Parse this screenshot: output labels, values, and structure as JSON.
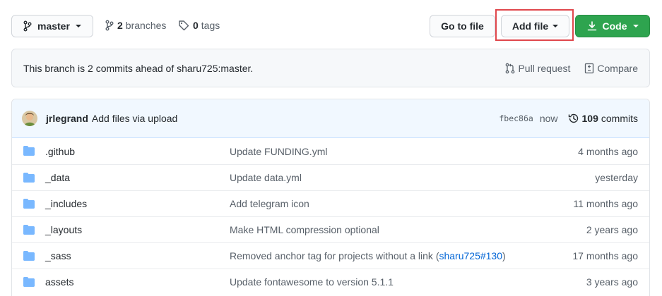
{
  "toolbar": {
    "branch_label": "master",
    "branches_count": "2",
    "branches_word": "branches",
    "tags_count": "0",
    "tags_word": "tags",
    "goto_label": "Go to file",
    "addfile_label": "Add file",
    "code_label": "Code"
  },
  "ahead": {
    "text": "This branch is 2 commits ahead of sharu725:master.",
    "pull_request": "Pull request",
    "compare": "Compare"
  },
  "commit": {
    "author": "jrlegrand",
    "message": "Add files via upload",
    "sha": "fbec86a",
    "age": "now",
    "count": "109",
    "count_word": "commits"
  },
  "files": [
    {
      "name": ".github",
      "message": "Update FUNDING.yml",
      "age": "4 months ago"
    },
    {
      "name": "_data",
      "message": "Update data.yml",
      "age": "yesterday"
    },
    {
      "name": "_includes",
      "message": "Add telegram icon",
      "age": "11 months ago"
    },
    {
      "name": "_layouts",
      "message": "Make HTML compression optional",
      "age": "2 years ago"
    },
    {
      "name": "_sass",
      "message": "Removed anchor tag for projects without a link (",
      "link": "sharu725#130",
      "message_end": ")",
      "age": "17 months ago"
    },
    {
      "name": "assets",
      "message": "Update fontawesome to version 5.1.1",
      "age": "3 years ago"
    }
  ],
  "icons": {
    "branch": "git-branch-icon",
    "tag": "tag-icon",
    "download": "download-icon",
    "pull_request": "pull-request-icon",
    "compare": "compare-icon",
    "history": "history-icon",
    "folder": "folder-icon"
  },
  "colors": {
    "primary_green": "#2ea44f",
    "link_blue": "#0366d6",
    "folder_blue": "#79b8ff",
    "highlight_red": "#e0474c",
    "commit_header_bg": "#f1f8ff"
  }
}
